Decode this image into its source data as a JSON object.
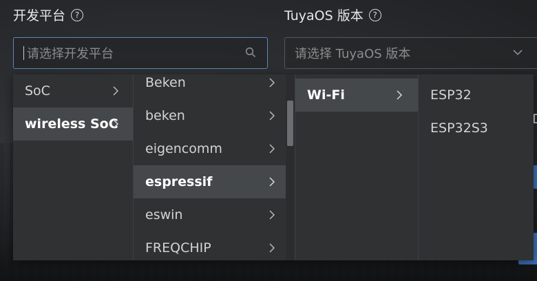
{
  "dev_platform": {
    "label": "开发平台",
    "placeholder": "请选择开发平台"
  },
  "tuyaos_version": {
    "label": "TuyaOS 版本",
    "placeholder": "请选择 TuyaOS 版本"
  },
  "cascader": {
    "level1": [
      {
        "label": "SoC"
      },
      {
        "label": "wireless SoC"
      }
    ],
    "level2": [
      {
        "label": "Beken"
      },
      {
        "label": "beken"
      },
      {
        "label": "eigencomm"
      },
      {
        "label": "espressif"
      },
      {
        "label": "eswin"
      },
      {
        "label": "FREQCHIP"
      }
    ],
    "level3": [
      {
        "label": "Wi-Fi"
      }
    ],
    "level4": [
      {
        "label": "ESP32"
      },
      {
        "label": "ESP32S3"
      }
    ]
  },
  "background_partial_text": "D",
  "icons": {
    "help": "question-circle-icon",
    "search": "search-icon",
    "dropdown": "chevron-down-icon",
    "expand": "chevron-right-icon"
  },
  "colors": {
    "accent_border": "#5d87b7",
    "selected_bg": "#45484b",
    "panel_bg": "#2f3133",
    "side_button": "#3b73c0"
  }
}
